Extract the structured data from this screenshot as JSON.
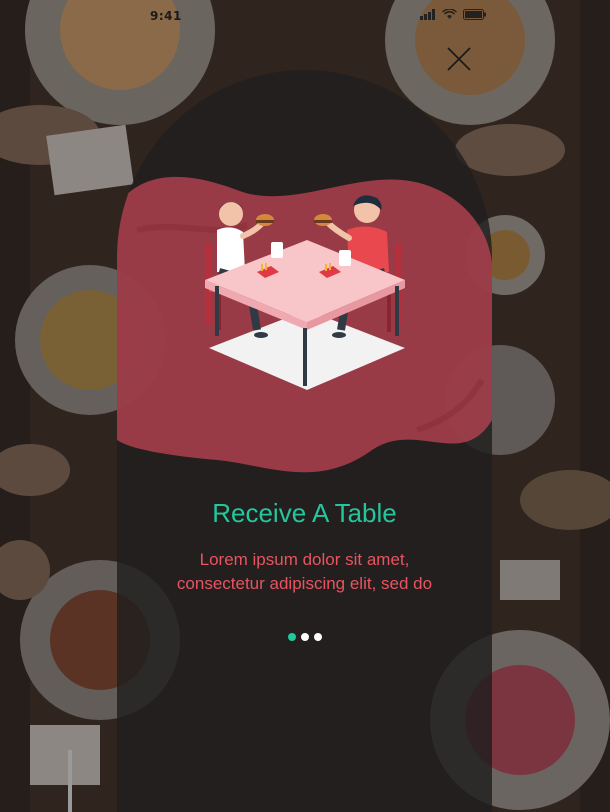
{
  "status_bar": {
    "time": "9:41"
  },
  "onboarding": {
    "title": "Receive A Table",
    "description_line1": "Lorem ipsum dolor sit amet,",
    "description_line2": "consectetur adipiscing elit, sed do",
    "page_indicator": {
      "total_pages": 3,
      "active_page": 1
    }
  },
  "icons": {
    "close": "close-icon",
    "signal": "signal-icon",
    "wifi": "wifi-icon",
    "battery": "battery-icon"
  },
  "colors": {
    "title": "#23c79d",
    "description": "#e8545f",
    "accent_blob": "#a8404d",
    "dot_active": "#1ec99d",
    "dot_inactive": "#ffffff",
    "card_overlay": "#201e1f"
  }
}
